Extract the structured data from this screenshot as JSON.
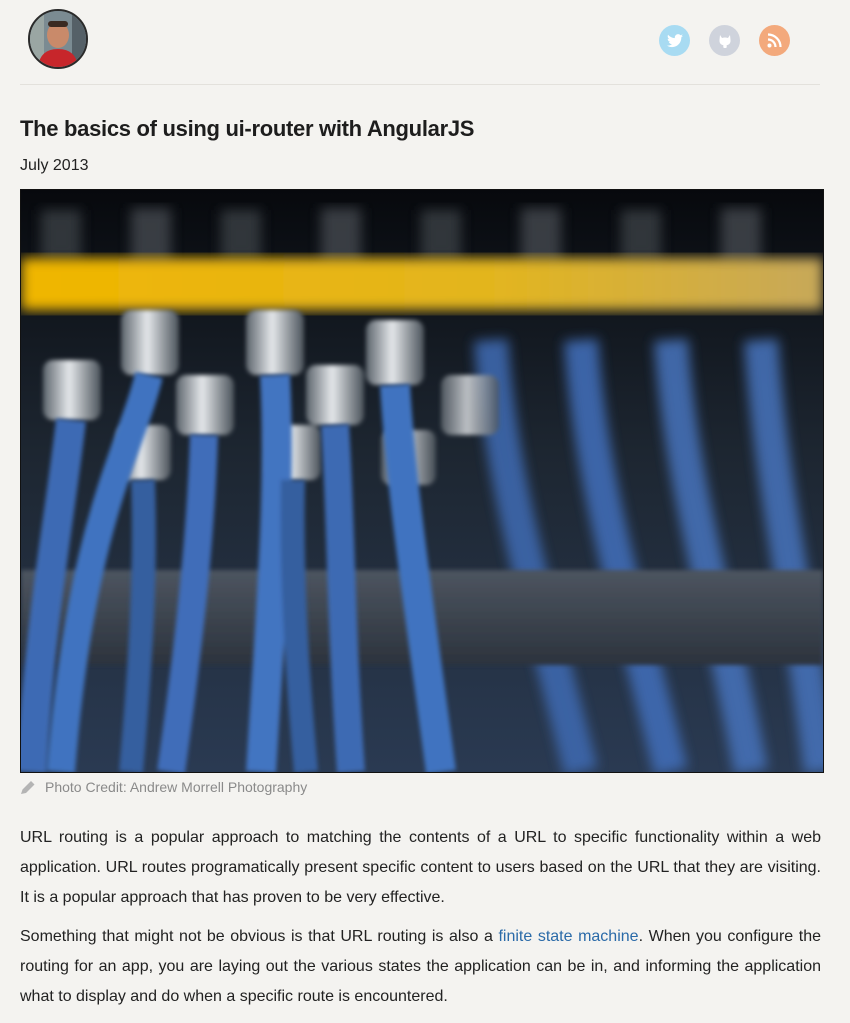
{
  "header": {
    "icons": [
      "avatar-photo",
      "twitter-icon",
      "github-icon",
      "rss-icon"
    ],
    "colors": {
      "twitter": "#a8dbf2",
      "github": "#cfd3dc",
      "rss": "#f3a97c"
    }
  },
  "article": {
    "title": "The basics of using ui-router with AngularJS",
    "date": "July 2013",
    "photo_credit": "Photo Credit: Andrew Morrell Photography",
    "p1": "URL routing is a popular approach to matching the contents of a URL to specific functionality within a web application. URL routes programatically present specific content to users based on the URL that they are visiting. It is a popular approach that has proven to be very effective.",
    "p2_before": "Something that might not be obvious is that URL routing is also a ",
    "p2_link": "finite state machine",
    "p2_after": ". When you configure the routing for an app, you are laying out the various states the application can be in, and informing the application what to display and do when a specific route is encountered."
  },
  "colors": {
    "background": "#f4f3f0",
    "link": "#2a6aa8",
    "cable_blue": "#3f6db9",
    "band_yellow": "#e9b400"
  }
}
